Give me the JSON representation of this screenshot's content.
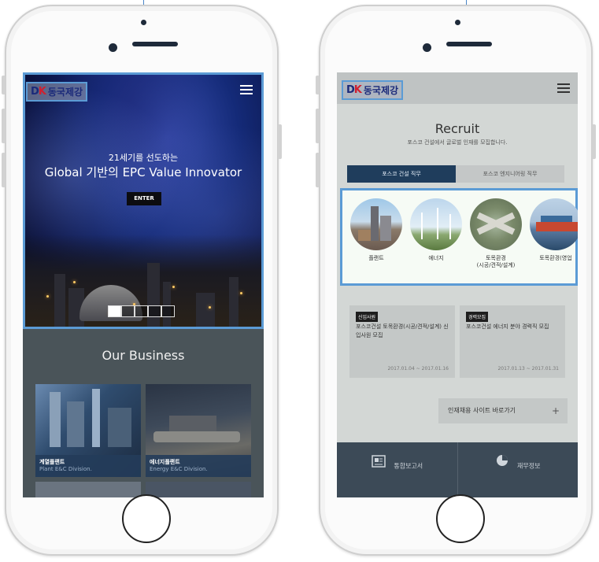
{
  "left": {
    "logo_text": "동국제강",
    "hero": {
      "subtitle": "21세기를 선도하는",
      "title": "Global 기반의 EPC Value Innovator",
      "enter_label": "ENTER",
      "slides_total": 5,
      "slide_active": 1
    },
    "business": {
      "title": "Our Business",
      "cards": [
        {
          "kor": "계열플랜트",
          "eng": "Plant E&C Division."
        },
        {
          "kor": "에너지플랜트",
          "eng": "Energy E&C Division."
        }
      ]
    }
  },
  "right": {
    "logo_text": "동국제강",
    "recruit": {
      "title": "Recruit",
      "subtitle": "포스코 건설에서 글로벌 인재를 모집합니다.",
      "tabs": [
        "포스코 건설 직무",
        "포스코 엔지니어링 직무"
      ],
      "jobs": [
        {
          "label": "플랜트"
        },
        {
          "label": "에너지"
        },
        {
          "label": "토목환경\n(시공/견적/설계)"
        },
        {
          "label": "토목환경(영업"
        }
      ],
      "posts": [
        {
          "badge": "신입사원",
          "text": "포스코건설 토목환경(시공/견적/설계) 신입사원 모집",
          "date": "2017.01.04 ~ 2017.01.16"
        },
        {
          "badge": "경력모집",
          "text": "포스코건설 에너지 분야 경력직 모집",
          "date": "2017.01.13 ~ 2017.01.31"
        }
      ],
      "site_link": "인재채용 사이트 바로가기",
      "site_plus": "+"
    },
    "footer": {
      "items": [
        "통합보고서",
        "재무정보"
      ]
    }
  },
  "colors": {
    "highlight": "#5b9bd5",
    "tab_active": "#1f3d5c",
    "footer": "#3c4a57"
  }
}
